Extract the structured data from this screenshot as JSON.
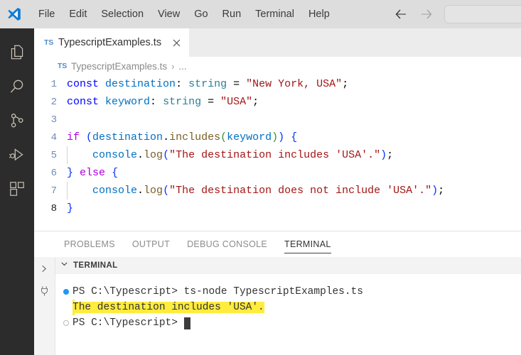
{
  "titlebar": {
    "logo_icon": "vscode-logo-icon",
    "menu": [
      {
        "label": "File"
      },
      {
        "label": "Edit"
      },
      {
        "label": "Selection"
      },
      {
        "label": "View"
      },
      {
        "label": "Go"
      },
      {
        "label": "Run"
      },
      {
        "label": "Terminal"
      },
      {
        "label": "Help"
      }
    ],
    "back_icon": "arrow-left-icon",
    "forward_icon": "arrow-right-icon",
    "search_value": "",
    "search_placeholder": ""
  },
  "activitybar": {
    "items": [
      {
        "name": "explorer",
        "icon": "files-icon"
      },
      {
        "name": "search",
        "icon": "search-icon"
      },
      {
        "name": "source-control",
        "icon": "source-control-icon"
      },
      {
        "name": "run-and-debug",
        "icon": "run-debug-icon"
      },
      {
        "name": "extensions",
        "icon": "extensions-icon"
      }
    ]
  },
  "editor": {
    "tab": {
      "badge": "TS",
      "title": "TypescriptExamples.ts",
      "close_icon": "close-icon"
    },
    "breadcrumb": {
      "badge": "TS",
      "file": "TypescriptExamples.ts",
      "separator": "›",
      "ellipsis": "..."
    },
    "lines": [
      {
        "num": "1",
        "text": "const destination: string = \"New York, USA\";"
      },
      {
        "num": "2",
        "text": "const keyword: string = \"USA\";"
      },
      {
        "num": "3",
        "text": ""
      },
      {
        "num": "4",
        "text": "if (destination.includes(keyword)) {"
      },
      {
        "num": "5",
        "text": "    console.log(\"The destination includes 'USA'.\");"
      },
      {
        "num": "6",
        "text": "} else {"
      },
      {
        "num": "7",
        "text": "    console.log(\"The destination does not include 'USA'.\");"
      },
      {
        "num": "8",
        "text": "}"
      }
    ],
    "tokens": {
      "const": "const",
      "destination": "destination",
      "colon": ":",
      "string_type": "string",
      "equals": "=",
      "str_newyork": "\"New York, USA\"",
      "semicolon": ";",
      "keyword_var": "keyword",
      "str_usa": "\"USA\"",
      "if": "if",
      "includes": "includes",
      "console": "console",
      "log": "log",
      "str_includes_msg": "\"The destination includes 'USA'.\"",
      "str_not_include_msg": "\"The destination does not include 'USA'.\"",
      "else": "else",
      "open_brace": "{",
      "close_brace": "}"
    }
  },
  "panel": {
    "tabs": [
      {
        "label": "PROBLEMS",
        "active": false
      },
      {
        "label": "OUTPUT",
        "active": false
      },
      {
        "label": "DEBUG CONSOLE",
        "active": false
      },
      {
        "label": "TERMINAL",
        "active": true
      }
    ],
    "side_icons": [
      {
        "name": "terminal-chevron-icon"
      },
      {
        "name": "plug-icon"
      }
    ],
    "header": {
      "chevron_icon": "chevron-down-icon",
      "label": "TERMINAL"
    },
    "terminal": {
      "lines": [
        {
          "marker": "dot-filled",
          "prompt": "PS C:\\Typescript>",
          "command": " ts-node TypescriptExamples.ts",
          "highlighted": false
        },
        {
          "marker": "none",
          "prompt": "",
          "command": "The destination includes 'USA'.",
          "highlighted": true
        },
        {
          "marker": "dot-hollow",
          "prompt": "PS C:\\Typescript>",
          "command": " ",
          "highlighted": false,
          "cursor": true
        }
      ]
    }
  },
  "colors": {
    "titlebar_bg": "#dddddd",
    "activitybar_bg": "#2c2c2c",
    "editor_bg": "#ffffff",
    "tabbar_bg": "#ececec",
    "accent_blue": "#007acc",
    "highlight_yellow": "#ffec3d",
    "string_red": "#a31515",
    "keyword_blue": "#0000ff",
    "control_purple": "#af00db",
    "function_gold": "#795e26",
    "variable_blue": "#0070c1",
    "type_teal": "#267f99"
  }
}
